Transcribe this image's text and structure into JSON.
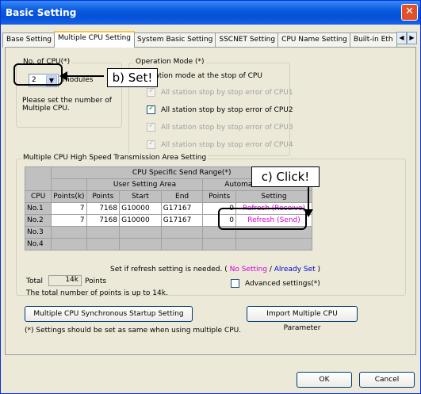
{
  "window": {
    "title": "Basic Setting",
    "close_glyph": "✕"
  },
  "tabs": [
    {
      "label": "Base Setting",
      "active": false
    },
    {
      "label": "Multiple CPU Setting",
      "active": true
    },
    {
      "label": "System Basic Setting",
      "active": false
    },
    {
      "label": "SSCNET Setting",
      "active": false
    },
    {
      "label": "CPU Name Setting",
      "active": false
    },
    {
      "label": "Built-in Eth",
      "active": false
    }
  ],
  "tab_scroll": {
    "left": "◀",
    "right": "▶"
  },
  "no_cpu": {
    "legend": "No. of CPU(*)",
    "value": "2",
    "unit": "modules",
    "hint_line1": "Please set the number of",
    "hint_line2": "Multiple CPU."
  },
  "operation_mode": {
    "legend": "Operation Mode (*)",
    "line1": "All station mode at the stop of CPU",
    "items": [
      {
        "label": "All station stop by stop error of CPU1",
        "checked": true,
        "enabled": false
      },
      {
        "label": "All station stop by stop error of CPU2",
        "checked": true,
        "enabled": true
      },
      {
        "label": "All station stop by stop error of CPU3",
        "checked": true,
        "enabled": false
      },
      {
        "label": "All station stop by stop error of CPU4",
        "checked": true,
        "enabled": false
      }
    ]
  },
  "transmission": {
    "legend": "Multiple CPU High Speed Transmission Area Setting",
    "header_top": "CPU Specific Send Range(*)",
    "header_user": "User Setting Area",
    "header_auto": "Automatic Refresh",
    "columns": [
      "CPU",
      "Points(k)",
      "Points",
      "Start",
      "End",
      "Points",
      "Setting"
    ],
    "rows": [
      {
        "cpu": "No.1",
        "points_k": "7",
        "points": "7168",
        "start": "G10000",
        "end": "G17167",
        "auto_points": "0",
        "setting": "Refresh (Receive)"
      },
      {
        "cpu": "No.2",
        "points_k": "7",
        "points": "7168",
        "start": "G10000",
        "end": "G17167",
        "auto_points": "0",
        "setting": "Refresh (Send)"
      },
      {
        "cpu": "No.3",
        "points_k": "",
        "points": "",
        "start": "",
        "end": "",
        "auto_points": "",
        "setting": ""
      },
      {
        "cpu": "No.4",
        "points_k": "",
        "points": "",
        "start": "",
        "end": "",
        "auto_points": "",
        "setting": ""
      }
    ],
    "refresh_note": "Set if refresh setting is needed. (",
    "no_setting": "No Setting",
    "slash": "/",
    "already_set": "Already Set",
    "close_paren": ")",
    "total_label": "Total",
    "total_value": "14k",
    "total_unit": "Points",
    "advanced_label": "Advanced settings(*)",
    "total_note": "The total number of points is up to 14k."
  },
  "buttons": {
    "sync_startup": "Multiple CPU Synchronous Startup Setting",
    "import_param": "Import Multiple CPU Parameter",
    "ok": "OK",
    "cancel": "Cancel"
  },
  "footnote": "(*) Settings should be set as same when using multiple CPU.",
  "annotations": {
    "set": "b) Set!",
    "click": "c) Click!"
  },
  "colors": {
    "title_bar": "#0a5ae0",
    "no_setting": "#d400d4",
    "already_set": "#0000cc",
    "annotation_box": "#000000"
  }
}
